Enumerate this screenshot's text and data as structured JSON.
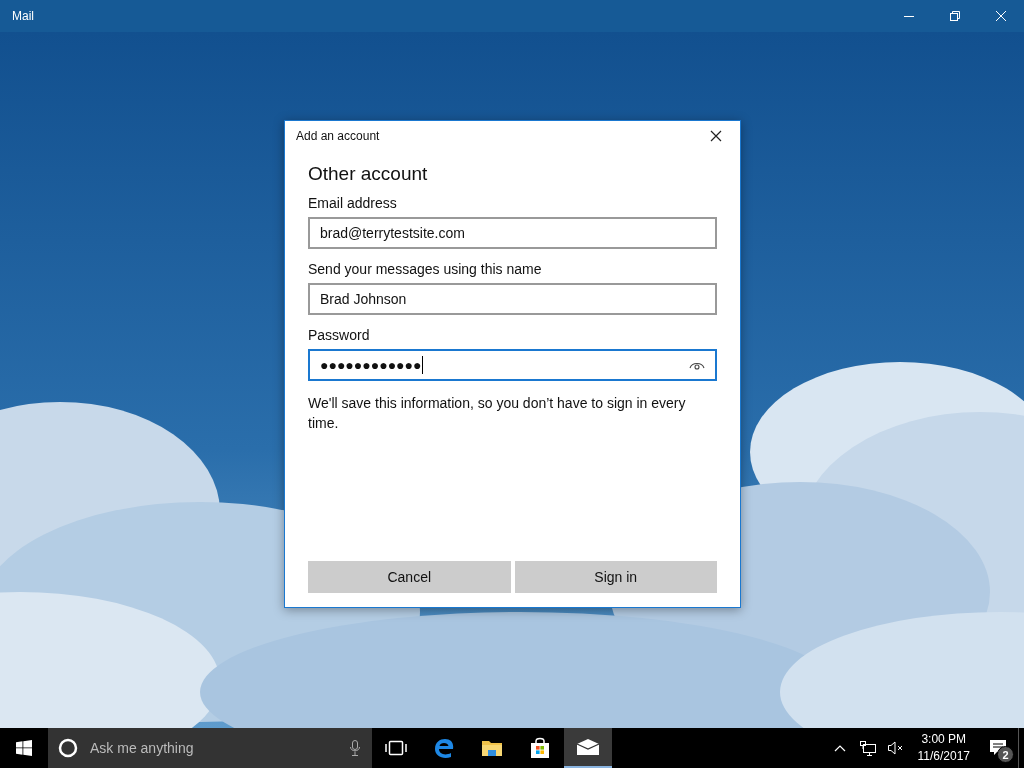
{
  "window": {
    "title": "Mail"
  },
  "dialog": {
    "title": "Add an account",
    "heading": "Other account",
    "fields": [
      {
        "label": "Email address",
        "value": "brad@terrytestsite.com",
        "focused": false,
        "kind": "text"
      },
      {
        "label": "Send your messages using this name",
        "value": "Brad Johnson",
        "focused": false,
        "kind": "text"
      },
      {
        "label": "Password",
        "value": "●●●●●●●●●●●●",
        "focused": true,
        "kind": "password"
      }
    ],
    "note": "We'll save this information, so you don’t have to sign in every time.",
    "buttons": [
      "Cancel",
      "Sign in"
    ]
  },
  "taskbar": {
    "search": {
      "placeholder": "Ask me anything"
    },
    "apps": [
      {
        "kind": "task-view",
        "selected": false
      },
      {
        "kind": "browser",
        "selected": false
      },
      {
        "kind": "folder",
        "selected": false
      },
      {
        "kind": "store",
        "selected": false
      },
      {
        "kind": "mail",
        "selected": true
      }
    ],
    "clock": {
      "time": "3:00 PM",
      "date": "11/6/2017"
    },
    "notifications": {
      "count": "2"
    }
  }
}
